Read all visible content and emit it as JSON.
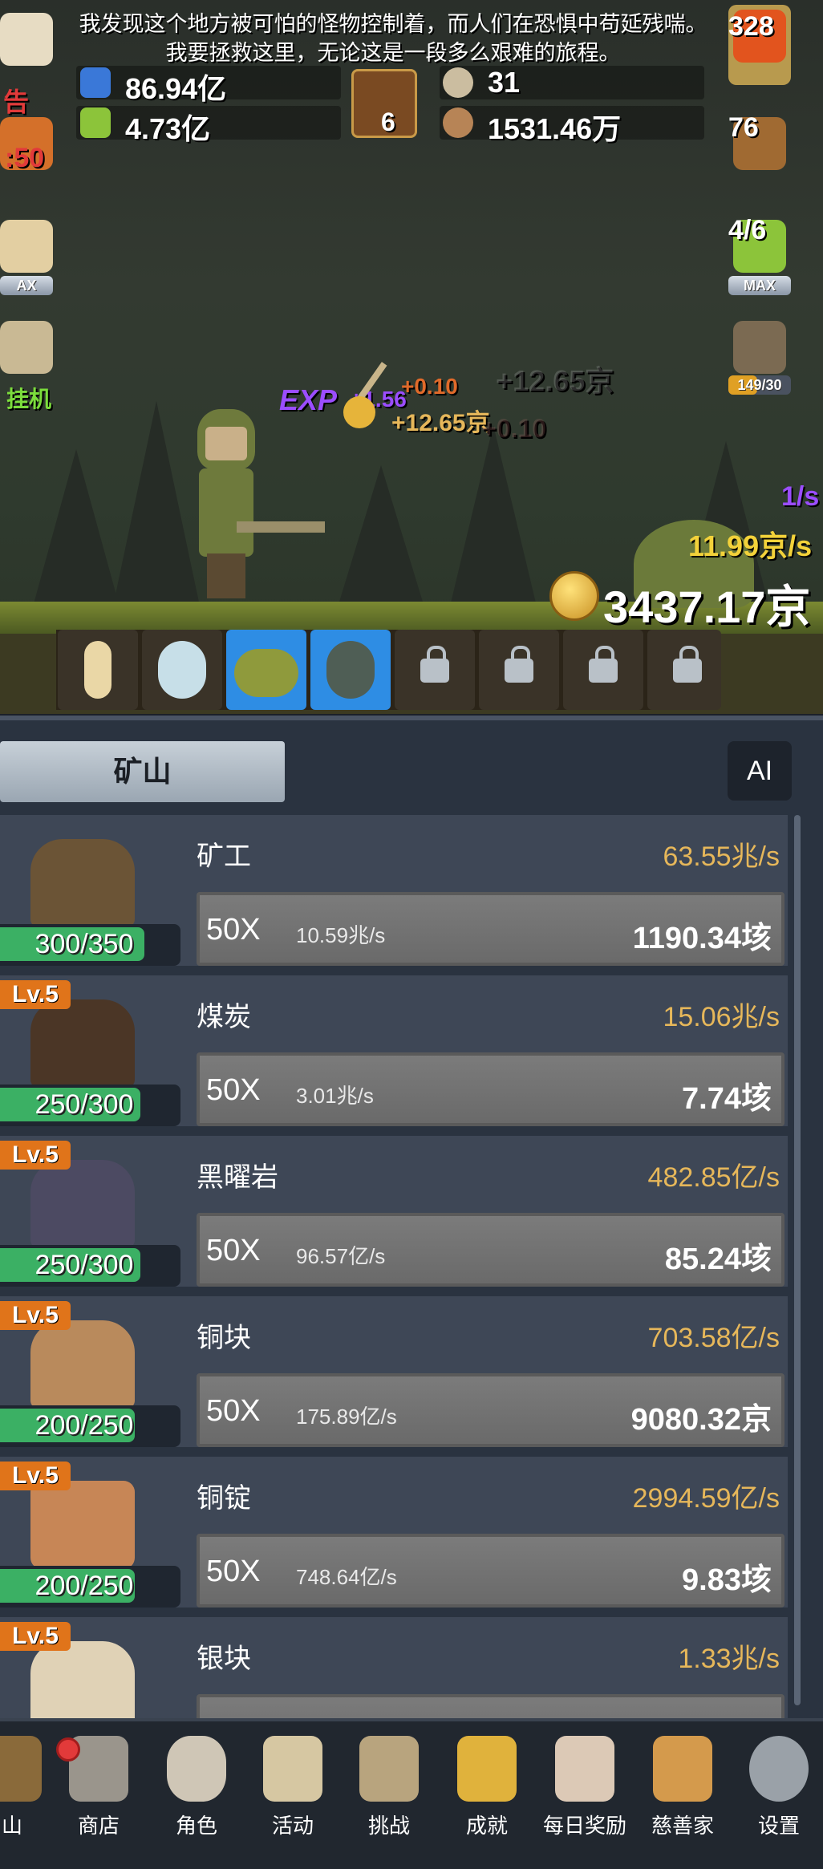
{
  "story": {
    "line1": "我发现这个地方被可怕的怪物控制着，而人们在恐惧中苟延残喘。",
    "line2": "我要拯救这里，无论这是一段多么艰难的旅程。"
  },
  "resources": {
    "blue_potion": "86.94亿",
    "green_potion": "4.73亿",
    "book": "6",
    "stone_coin": "31",
    "nut": "1531.46万"
  },
  "left_side": {
    "ad_text": "告",
    "timer": ":50",
    "max_label": "AX",
    "idle_label": "挂机"
  },
  "right_side": {
    "potion_count": "328",
    "chest_count": "76",
    "slime_count": "4/6",
    "max_label": "MAX",
    "sword_level": "14",
    "sword_progress": "9/30"
  },
  "floats": {
    "exp_label": "EXP",
    "exp_value": "+1.56",
    "plus_small": "+0.10",
    "plus_gold": "+12.65京",
    "ghost_gold": "+12.65京",
    "ghost_small": "+0.10"
  },
  "rates": {
    "purple_rate": "1/s",
    "gold_rate": "11.99京/s"
  },
  "gold_total": "3437.17京",
  "panel": {
    "tab_label": "矿山",
    "ai_label": "AI",
    "cards": [
      {
        "name": "矿工",
        "rate": "63.55兆/s",
        "mult": "50X",
        "unit_rate": "10.59兆/s",
        "cost": "1190.34垓",
        "progress": "300/350",
        "fill": 0.857
      },
      {
        "lv": "Lv.5",
        "name": "煤炭",
        "rate": "15.06兆/s",
        "mult": "50X",
        "unit_rate": "3.01兆/s",
        "cost": "7.74垓",
        "progress": "250/300",
        "fill": 0.833
      },
      {
        "lv": "Lv.5",
        "name": "黑曜岩",
        "rate": "482.85亿/s",
        "mult": "50X",
        "unit_rate": "96.57亿/s",
        "cost": "85.24垓",
        "progress": "250/300",
        "fill": 0.833
      },
      {
        "lv": "Lv.5",
        "name": "铜块",
        "rate": "703.58亿/s",
        "mult": "50X",
        "unit_rate": "175.89亿/s",
        "cost": "9080.32京",
        "progress": "200/250",
        "fill": 0.8
      },
      {
        "lv": "Lv.5",
        "name": "铜锭",
        "rate": "2994.59亿/s",
        "mult": "50X",
        "unit_rate": "748.64亿/s",
        "cost": "9.83垓",
        "progress": "200/250",
        "fill": 0.8
      },
      {
        "lv": "Lv.5",
        "name": "银块",
        "rate": "1.33兆/s"
      }
    ]
  },
  "nav": [
    {
      "label": "山",
      "icon": "lantern-icon"
    },
    {
      "label": "商店",
      "icon": "shop-icon"
    },
    {
      "label": "角色",
      "icon": "skull-icon"
    },
    {
      "label": "活动",
      "icon": "scroll-icon"
    },
    {
      "label": "挑战",
      "icon": "map-icon"
    },
    {
      "label": "成就",
      "icon": "key-icon"
    },
    {
      "label": "每日奖励",
      "icon": "letter-icon"
    },
    {
      "label": "慈善家",
      "icon": "bread-icon"
    },
    {
      "label": "设置",
      "icon": "gear-icon"
    }
  ],
  "colors": {
    "accent_gold": "#e6b75a",
    "progress_green": "#3bb064",
    "level_orange": "#e0741a",
    "active_slot": "#2e8de4",
    "exp_purple": "#9b4dff",
    "rate_yellow": "#f3d23a"
  }
}
